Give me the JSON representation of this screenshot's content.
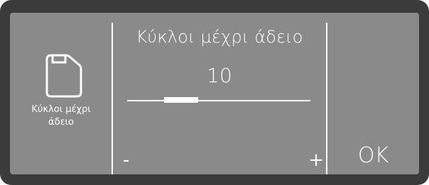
{
  "left_panel": {
    "icon": "canister-icon",
    "label_line1": "Κύκλοι μέχρι",
    "label_line2": "άδειο"
  },
  "center_panel": {
    "title": "Κύκλοι μέχρι άδειο",
    "value": "10",
    "slider_min_label": "-",
    "slider_max_label": "+"
  },
  "right_panel": {
    "ok_label": "OK"
  },
  "colors": {
    "screen_bg": "#8a8a8a",
    "bezel": "#3b3b3b",
    "foreground": "#ffffff"
  }
}
